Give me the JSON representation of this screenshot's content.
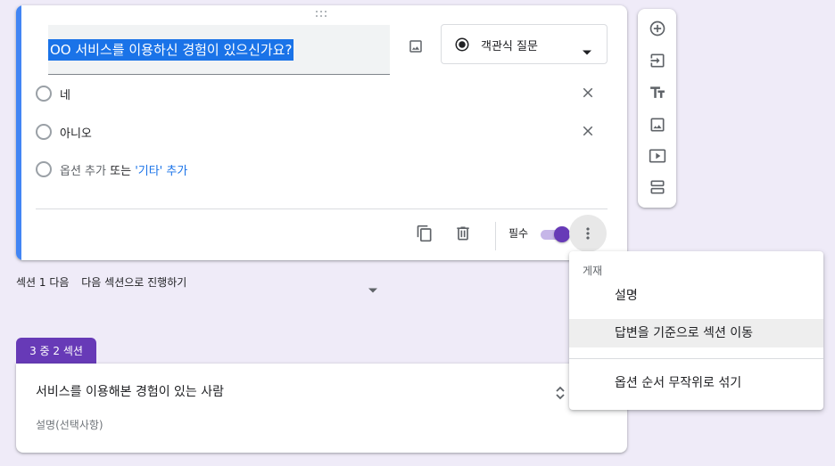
{
  "question": {
    "title": "OO 서비스를 이용하신 경험이 있으신가요?",
    "type_label": "객관식 질문",
    "options": [
      {
        "label": "네"
      },
      {
        "label": "아니오"
      }
    ],
    "add_option": "옵션 추가",
    "add_option_or": "또는",
    "add_other": "'기타' 추가",
    "required_label": "필수",
    "required": true
  },
  "after_section": {
    "label": "섹션 1 다음",
    "value": "다음 섹션으로 진행하기"
  },
  "section2": {
    "tab_label": "3 중 2 섹션",
    "title": "서비스를 이용해본 경험이 있는 사람",
    "description": "설명(선택사항)"
  },
  "menu": {
    "header": "게재",
    "items": [
      {
        "label": "설명"
      },
      {
        "label": "답변을 기준으로 섹션 이동"
      },
      {
        "label": "옵션 순서 무작위로 섞기"
      }
    ]
  },
  "colors": {
    "accent": "#4285f4",
    "primary": "#673ab7",
    "selection": "#1a73e8",
    "background": "#efebf8"
  },
  "icons": {
    "image": "image-icon",
    "radio": "radio-button-icon",
    "dropdown": "caret-down-icon",
    "close": "close-icon",
    "copy": "copy-icon",
    "delete": "trash-icon",
    "more": "more-vert-icon",
    "add_question": "add-circle-icon",
    "import": "import-icon",
    "title": "text-title-icon",
    "add_image": "image-icon",
    "add_video": "video-icon",
    "add_section": "section-icon",
    "collapse": "collapse-icon"
  }
}
